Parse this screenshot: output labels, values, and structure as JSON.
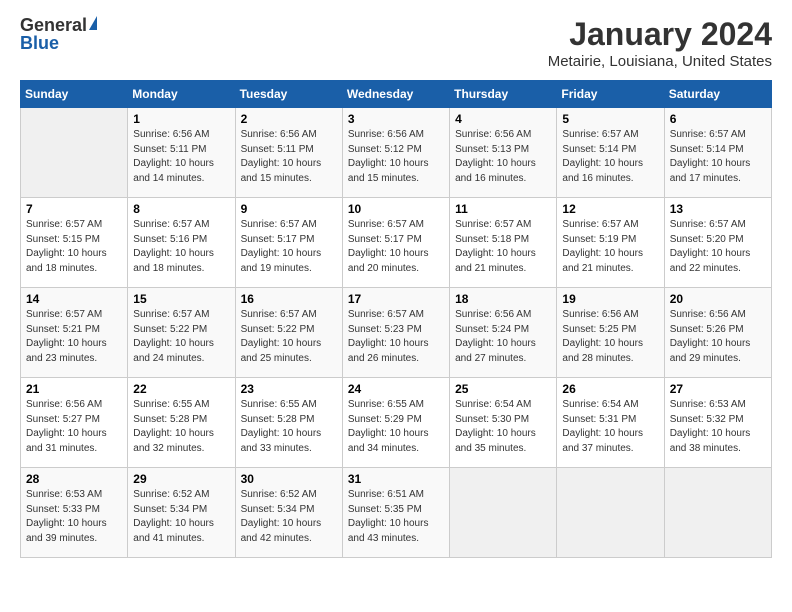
{
  "header": {
    "logo_general": "General",
    "logo_blue": "Blue",
    "title": "January 2024",
    "location": "Metairie, Louisiana, United States"
  },
  "calendar": {
    "days_of_week": [
      "Sunday",
      "Monday",
      "Tuesday",
      "Wednesday",
      "Thursday",
      "Friday",
      "Saturday"
    ],
    "weeks": [
      [
        {
          "num": "",
          "info": ""
        },
        {
          "num": "1",
          "info": "Sunrise: 6:56 AM\nSunset: 5:11 PM\nDaylight: 10 hours\nand 14 minutes."
        },
        {
          "num": "2",
          "info": "Sunrise: 6:56 AM\nSunset: 5:11 PM\nDaylight: 10 hours\nand 15 minutes."
        },
        {
          "num": "3",
          "info": "Sunrise: 6:56 AM\nSunset: 5:12 PM\nDaylight: 10 hours\nand 15 minutes."
        },
        {
          "num": "4",
          "info": "Sunrise: 6:56 AM\nSunset: 5:13 PM\nDaylight: 10 hours\nand 16 minutes."
        },
        {
          "num": "5",
          "info": "Sunrise: 6:57 AM\nSunset: 5:14 PM\nDaylight: 10 hours\nand 16 minutes."
        },
        {
          "num": "6",
          "info": "Sunrise: 6:57 AM\nSunset: 5:14 PM\nDaylight: 10 hours\nand 17 minutes."
        }
      ],
      [
        {
          "num": "7",
          "info": "Sunrise: 6:57 AM\nSunset: 5:15 PM\nDaylight: 10 hours\nand 18 minutes."
        },
        {
          "num": "8",
          "info": "Sunrise: 6:57 AM\nSunset: 5:16 PM\nDaylight: 10 hours\nand 18 minutes."
        },
        {
          "num": "9",
          "info": "Sunrise: 6:57 AM\nSunset: 5:17 PM\nDaylight: 10 hours\nand 19 minutes."
        },
        {
          "num": "10",
          "info": "Sunrise: 6:57 AM\nSunset: 5:17 PM\nDaylight: 10 hours\nand 20 minutes."
        },
        {
          "num": "11",
          "info": "Sunrise: 6:57 AM\nSunset: 5:18 PM\nDaylight: 10 hours\nand 21 minutes."
        },
        {
          "num": "12",
          "info": "Sunrise: 6:57 AM\nSunset: 5:19 PM\nDaylight: 10 hours\nand 21 minutes."
        },
        {
          "num": "13",
          "info": "Sunrise: 6:57 AM\nSunset: 5:20 PM\nDaylight: 10 hours\nand 22 minutes."
        }
      ],
      [
        {
          "num": "14",
          "info": "Sunrise: 6:57 AM\nSunset: 5:21 PM\nDaylight: 10 hours\nand 23 minutes."
        },
        {
          "num": "15",
          "info": "Sunrise: 6:57 AM\nSunset: 5:22 PM\nDaylight: 10 hours\nand 24 minutes."
        },
        {
          "num": "16",
          "info": "Sunrise: 6:57 AM\nSunset: 5:22 PM\nDaylight: 10 hours\nand 25 minutes."
        },
        {
          "num": "17",
          "info": "Sunrise: 6:57 AM\nSunset: 5:23 PM\nDaylight: 10 hours\nand 26 minutes."
        },
        {
          "num": "18",
          "info": "Sunrise: 6:56 AM\nSunset: 5:24 PM\nDaylight: 10 hours\nand 27 minutes."
        },
        {
          "num": "19",
          "info": "Sunrise: 6:56 AM\nSunset: 5:25 PM\nDaylight: 10 hours\nand 28 minutes."
        },
        {
          "num": "20",
          "info": "Sunrise: 6:56 AM\nSunset: 5:26 PM\nDaylight: 10 hours\nand 29 minutes."
        }
      ],
      [
        {
          "num": "21",
          "info": "Sunrise: 6:56 AM\nSunset: 5:27 PM\nDaylight: 10 hours\nand 31 minutes."
        },
        {
          "num": "22",
          "info": "Sunrise: 6:55 AM\nSunset: 5:28 PM\nDaylight: 10 hours\nand 32 minutes."
        },
        {
          "num": "23",
          "info": "Sunrise: 6:55 AM\nSunset: 5:28 PM\nDaylight: 10 hours\nand 33 minutes."
        },
        {
          "num": "24",
          "info": "Sunrise: 6:55 AM\nSunset: 5:29 PM\nDaylight: 10 hours\nand 34 minutes."
        },
        {
          "num": "25",
          "info": "Sunrise: 6:54 AM\nSunset: 5:30 PM\nDaylight: 10 hours\nand 35 minutes."
        },
        {
          "num": "26",
          "info": "Sunrise: 6:54 AM\nSunset: 5:31 PM\nDaylight: 10 hours\nand 37 minutes."
        },
        {
          "num": "27",
          "info": "Sunrise: 6:53 AM\nSunset: 5:32 PM\nDaylight: 10 hours\nand 38 minutes."
        }
      ],
      [
        {
          "num": "28",
          "info": "Sunrise: 6:53 AM\nSunset: 5:33 PM\nDaylight: 10 hours\nand 39 minutes."
        },
        {
          "num": "29",
          "info": "Sunrise: 6:52 AM\nSunset: 5:34 PM\nDaylight: 10 hours\nand 41 minutes."
        },
        {
          "num": "30",
          "info": "Sunrise: 6:52 AM\nSunset: 5:34 PM\nDaylight: 10 hours\nand 42 minutes."
        },
        {
          "num": "31",
          "info": "Sunrise: 6:51 AM\nSunset: 5:35 PM\nDaylight: 10 hours\nand 43 minutes."
        },
        {
          "num": "",
          "info": ""
        },
        {
          "num": "",
          "info": ""
        },
        {
          "num": "",
          "info": ""
        }
      ]
    ]
  }
}
